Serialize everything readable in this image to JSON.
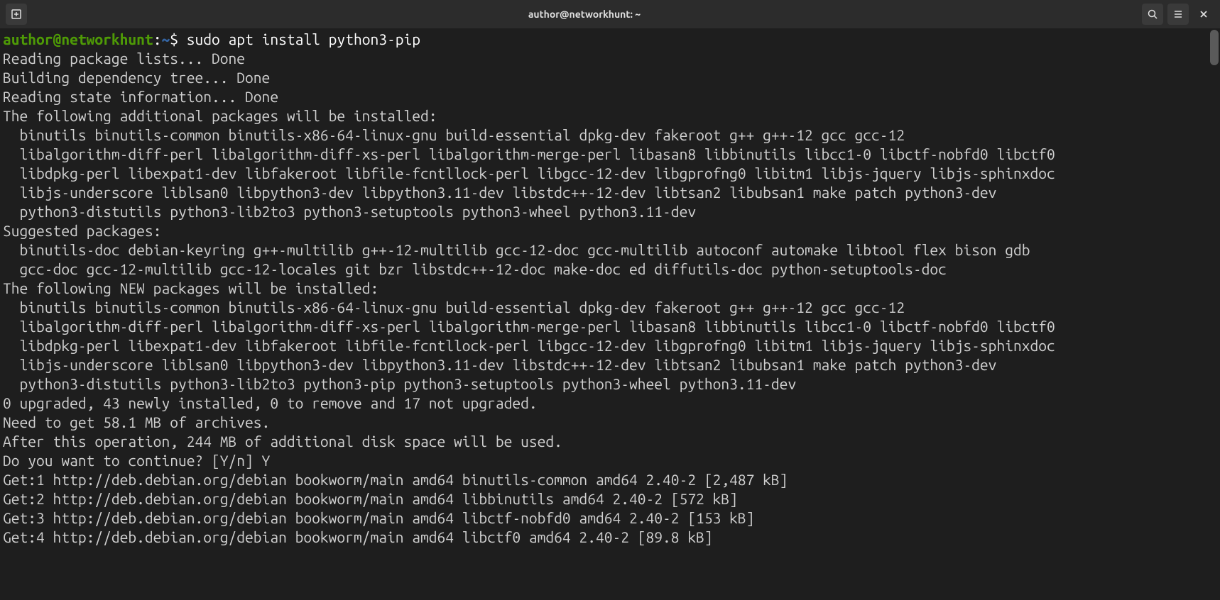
{
  "window": {
    "title": "author@networkhunt: ~"
  },
  "prompt": {
    "user_host": "author@networkhunt",
    "colon": ":",
    "path": "~",
    "dollar": "$"
  },
  "command": "sudo apt install python3-pip",
  "output": {
    "line1": "Reading package lists... Done",
    "line2": "Building dependency tree... Done",
    "line3": "Reading state information... Done",
    "line4": "The following additional packages will be installed:",
    "line5": "  binutils binutils-common binutils-x86-64-linux-gnu build-essential dpkg-dev fakeroot g++ g++-12 gcc gcc-12",
    "line6": "  libalgorithm-diff-perl libalgorithm-diff-xs-perl libalgorithm-merge-perl libasan8 libbinutils libcc1-0 libctf-nobfd0 libctf0",
    "line7": "  libdpkg-perl libexpat1-dev libfakeroot libfile-fcntllock-perl libgcc-12-dev libgprofng0 libitm1 libjs-jquery libjs-sphinxdoc",
    "line8": "  libjs-underscore liblsan0 libpython3-dev libpython3.11-dev libstdc++-12-dev libtsan2 libubsan1 make patch python3-dev",
    "line9": "  python3-distutils python3-lib2to3 python3-setuptools python3-wheel python3.11-dev",
    "line10": "Suggested packages:",
    "line11": "  binutils-doc debian-keyring g++-multilib g++-12-multilib gcc-12-doc gcc-multilib autoconf automake libtool flex bison gdb",
    "line12": "  gcc-doc gcc-12-multilib gcc-12-locales git bzr libstdc++-12-doc make-doc ed diffutils-doc python-setuptools-doc",
    "line13": "The following NEW packages will be installed:",
    "line14": "  binutils binutils-common binutils-x86-64-linux-gnu build-essential dpkg-dev fakeroot g++ g++-12 gcc gcc-12",
    "line15": "  libalgorithm-diff-perl libalgorithm-diff-xs-perl libalgorithm-merge-perl libasan8 libbinutils libcc1-0 libctf-nobfd0 libctf0",
    "line16": "  libdpkg-perl libexpat1-dev libfakeroot libfile-fcntllock-perl libgcc-12-dev libgprofng0 libitm1 libjs-jquery libjs-sphinxdoc",
    "line17": "  libjs-underscore liblsan0 libpython3-dev libpython3.11-dev libstdc++-12-dev libtsan2 libubsan1 make patch python3-dev",
    "line18": "  python3-distutils python3-lib2to3 python3-pip python3-setuptools python3-wheel python3.11-dev",
    "line19": "0 upgraded, 43 newly installed, 0 to remove and 17 not upgraded.",
    "line20": "Need to get 58.1 MB of archives.",
    "line21": "After this operation, 244 MB of additional disk space will be used.",
    "line22": "Do you want to continue? [Y/n] Y",
    "line23": "Get:1 http://deb.debian.org/debian bookworm/main amd64 binutils-common amd64 2.40-2 [2,487 kB]",
    "line24": "Get:2 http://deb.debian.org/debian bookworm/main amd64 libbinutils amd64 2.40-2 [572 kB]",
    "line25": "Get:3 http://deb.debian.org/debian bookworm/main amd64 libctf-nobfd0 amd64 2.40-2 [153 kB]",
    "line26": "Get:4 http://deb.debian.org/debian bookworm/main amd64 libctf0 amd64 2.40-2 [89.8 kB]"
  }
}
